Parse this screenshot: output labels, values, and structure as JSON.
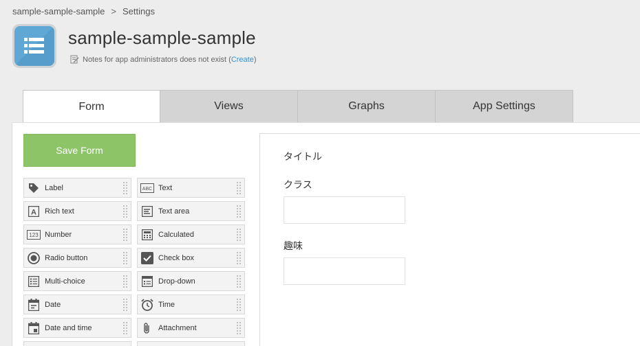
{
  "breadcrumb": {
    "app": "sample-sample-sample",
    "separator": ">",
    "current": "Settings"
  },
  "app": {
    "title": "sample-sample-sample",
    "notes_text": "Notes for app administrators does not exist (",
    "notes_link": "Create",
    "notes_close": ")"
  },
  "tabs": [
    {
      "label": "Form",
      "active": true
    },
    {
      "label": "Views",
      "active": false
    },
    {
      "label": "Graphs",
      "active": false
    },
    {
      "label": "App Settings",
      "active": false
    }
  ],
  "save_button": "Save Form",
  "palette": {
    "items": [
      {
        "label": "Label",
        "icon": "tag-icon"
      },
      {
        "label": "Text",
        "icon": "text-field-icon"
      },
      {
        "label": "Rich text",
        "icon": "rich-text-icon"
      },
      {
        "label": "Text area",
        "icon": "text-area-icon"
      },
      {
        "label": "Number",
        "icon": "number-icon"
      },
      {
        "label": "Calculated",
        "icon": "calculator-icon"
      },
      {
        "label": "Radio button",
        "icon": "radio-icon"
      },
      {
        "label": "Check box",
        "icon": "checkbox-icon"
      },
      {
        "label": "Multi-choice",
        "icon": "multi-choice-icon"
      },
      {
        "label": "Drop-down",
        "icon": "dropdown-icon"
      },
      {
        "label": "Date",
        "icon": "calendar-icon"
      },
      {
        "label": "Time",
        "icon": "clock-icon"
      },
      {
        "label": "Date and time",
        "icon": "datetime-icon"
      },
      {
        "label": "Attachment",
        "icon": "paperclip-icon"
      }
    ]
  },
  "form": {
    "fields": [
      {
        "label": "タイトル",
        "has_input": false
      },
      {
        "label": "クラス",
        "has_input": true,
        "value": ""
      },
      {
        "label": "趣味",
        "has_input": true,
        "value": ""
      }
    ]
  },
  "colors": {
    "save_button": "#8ec468",
    "link": "#3a8fd0",
    "tab_inactive": "#d4d4d4",
    "app_icon": "#5fa8d6"
  }
}
